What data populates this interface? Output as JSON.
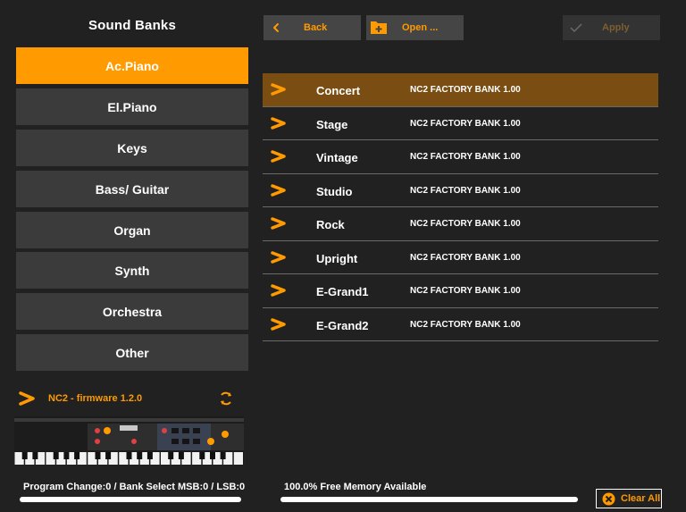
{
  "left_panel": {
    "title": "Sound Banks",
    "categories": [
      {
        "label": "Ac.Piano",
        "active": true
      },
      {
        "label": "El.Piano",
        "active": false
      },
      {
        "label": "Keys",
        "active": false
      },
      {
        "label": "Bass/ Guitar",
        "active": false
      },
      {
        "label": "Organ",
        "active": false
      },
      {
        "label": "Synth",
        "active": false
      },
      {
        "label": "Orchestra",
        "active": false
      },
      {
        "label": "Other",
        "active": false
      }
    ],
    "device": {
      "label": "NC2 - firmware 1.2.0",
      "icon": "chevron-right-icon",
      "action_icon": "refresh-icon"
    }
  },
  "toolbar": {
    "back_label": "Back",
    "back_icon": "chevron-left-icon",
    "open_label": "Open ...",
    "open_icon": "folder-add-icon",
    "apply_label": "Apply",
    "apply_icon": "checkmark-icon"
  },
  "banks": [
    {
      "name": "Concert",
      "bank": "NC2 FACTORY BANK 1.00",
      "selected": true
    },
    {
      "name": "Stage",
      "bank": "NC2 FACTORY BANK 1.00",
      "selected": false
    },
    {
      "name": "Vintage",
      "bank": "NC2 FACTORY BANK 1.00",
      "selected": false
    },
    {
      "name": "Studio",
      "bank": "NC2 FACTORY BANK 1.00",
      "selected": false
    },
    {
      "name": "Rock",
      "bank": "NC2 FACTORY BANK 1.00",
      "selected": false
    },
    {
      "name": "Upright",
      "bank": "NC2 FACTORY BANK 1.00",
      "selected": false
    },
    {
      "name": "E-Grand1",
      "bank": "NC2 FACTORY BANK 1.00",
      "selected": false
    },
    {
      "name": "E-Grand2",
      "bank": "NC2 FACTORY BANK 1.00",
      "selected": false
    }
  ],
  "status": {
    "program_text": "Program Change:0 / Bank Select MSB:0 / LSB:0",
    "memory_text": "100.0% Free Memory Available",
    "memory_free_fraction": 1.0
  },
  "clear_all_label": "Clear All",
  "colors": {
    "accent": "#ff9a00",
    "background": "#212121",
    "button": "#3b3b3b",
    "selected_row": "#7a4e12"
  }
}
